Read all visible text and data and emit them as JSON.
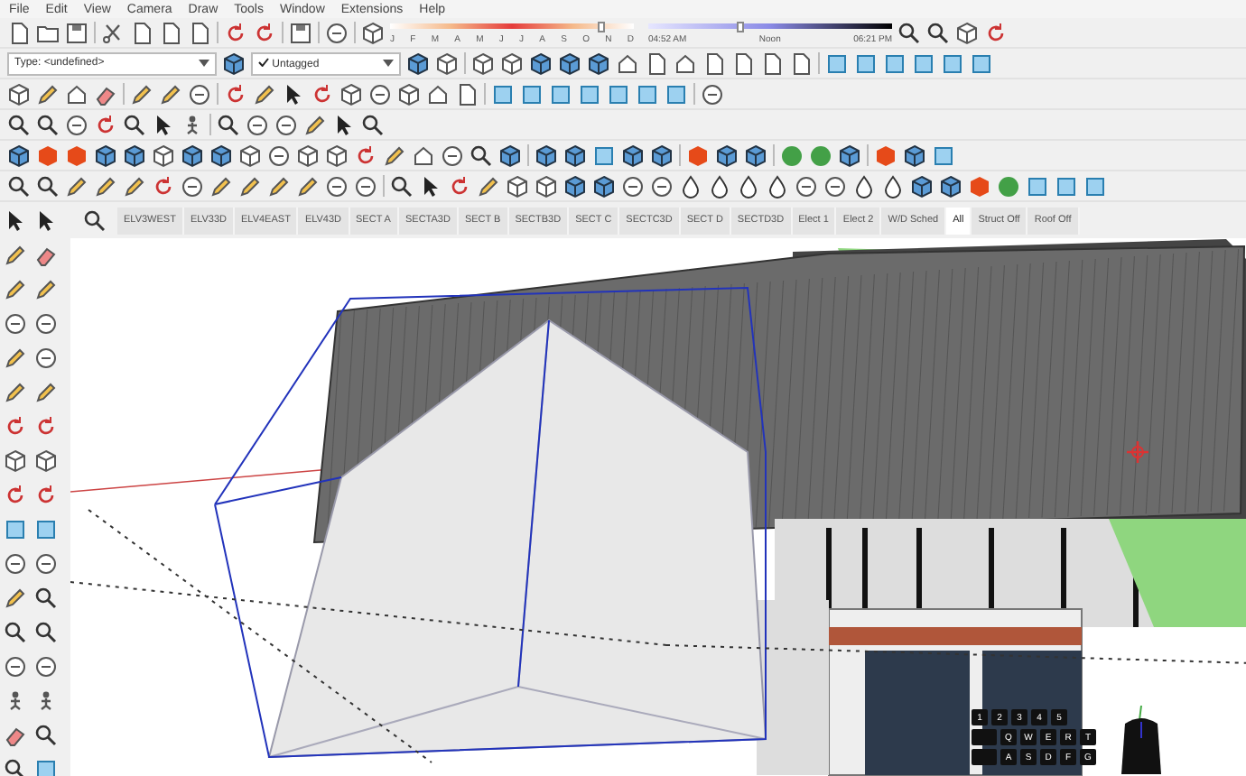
{
  "menu": [
    "File",
    "Edit",
    "View",
    "Camera",
    "Draw",
    "Tools",
    "Window",
    "Extensions",
    "Help"
  ],
  "shadow_settings": {
    "months": [
      "J",
      "F",
      "M",
      "A",
      "M",
      "J",
      "J",
      "A",
      "S",
      "O",
      "N",
      "D"
    ],
    "date_slider": {
      "level": 0.87
    },
    "time_slider": {
      "level": 0.38
    },
    "time_start": "04:52 AM",
    "time_mid": "Noon",
    "time_end": "06:21 PM"
  },
  "type_dropdown": {
    "value": "Type: <undefined>"
  },
  "tag_dropdown": {
    "value": "Untagged"
  },
  "scene_tabs": [
    {
      "label": "ELV3WEST",
      "selected": false
    },
    {
      "label": "ELV33D",
      "selected": false
    },
    {
      "label": "ELV4EAST",
      "selected": false
    },
    {
      "label": "ELV43D",
      "selected": false
    },
    {
      "label": "SECT A",
      "selected": false
    },
    {
      "label": "SECTA3D",
      "selected": false
    },
    {
      "label": "SECT B",
      "selected": false
    },
    {
      "label": "SECTB3D",
      "selected": false
    },
    {
      "label": "SECT C",
      "selected": false
    },
    {
      "label": "SECTC3D",
      "selected": false
    },
    {
      "label": "SECT D",
      "selected": false
    },
    {
      "label": "SECTD3D",
      "selected": false
    },
    {
      "label": "Elect 1",
      "selected": false
    },
    {
      "label": "Elect 2",
      "selected": false
    },
    {
      "label": "W/D Sched",
      "selected": false
    },
    {
      "label": "All",
      "selected": true
    },
    {
      "label": "Struct Off",
      "selected": false
    },
    {
      "label": "Roof Off",
      "selected": false
    }
  ],
  "keyboard_overlay": {
    "rows": [
      [
        "1",
        "2",
        "3",
        "4",
        "5"
      ],
      [
        "Q",
        "W",
        "E",
        "R",
        "T"
      ],
      [
        "A",
        "S",
        "D",
        "F",
        "G"
      ]
    ]
  }
}
